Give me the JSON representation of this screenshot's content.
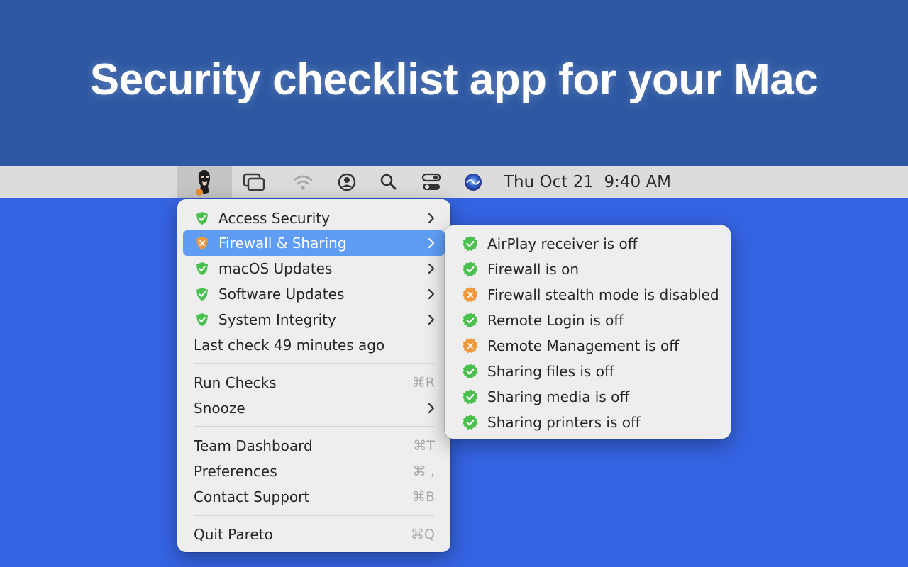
{
  "hero": {
    "title": "Security checklist app for your Mac"
  },
  "menubar": {
    "clock": "Thu Oct 21  9:40 AM",
    "icons": [
      "pareto-app-icon",
      "window-switcher-icon",
      "wifi-icon",
      "user-account-icon",
      "spotlight-search-icon",
      "control-center-icon",
      "siri-icon"
    ]
  },
  "menu": {
    "checks": [
      {
        "label": "Access Security",
        "status": "pass"
      },
      {
        "label": "Firewall & Sharing",
        "status": "warn",
        "highlighted": true
      },
      {
        "label": "macOS Updates",
        "status": "pass"
      },
      {
        "label": "Software Updates",
        "status": "pass"
      },
      {
        "label": "System Integrity",
        "status": "pass"
      }
    ],
    "last_check": "Last check 49 minutes ago",
    "run_checks": {
      "label": "Run Checks",
      "shortcut": "⌘R"
    },
    "snooze": {
      "label": "Snooze"
    },
    "team_dashboard": {
      "label": "Team Dashboard",
      "shortcut": "⌘T"
    },
    "preferences": {
      "label": "Preferences",
      "shortcut": "⌘ ,"
    },
    "contact_support": {
      "label": "Contact Support",
      "shortcut": "⌘B"
    },
    "quit": {
      "label": "Quit Pareto",
      "shortcut": "⌘Q"
    }
  },
  "submenu": {
    "items": [
      {
        "label": "AirPlay receiver is off",
        "status": "pass"
      },
      {
        "label": "Firewall is on",
        "status": "pass"
      },
      {
        "label": "Firewall stealth mode is disabled",
        "status": "warn"
      },
      {
        "label": "Remote Login is off",
        "status": "pass"
      },
      {
        "label": "Remote Management is off",
        "status": "warn"
      },
      {
        "label": "Sharing files is off",
        "status": "pass"
      },
      {
        "label": "Sharing media is off",
        "status": "pass"
      },
      {
        "label": "Sharing printers is off",
        "status": "pass"
      }
    ]
  },
  "colors": {
    "hero_bg": "#2e58a2",
    "desktop_bg": "#3563e2",
    "highlight": "#5f9df5",
    "pass_green": "#4cc04f",
    "warn_orange": "#f0993c"
  }
}
